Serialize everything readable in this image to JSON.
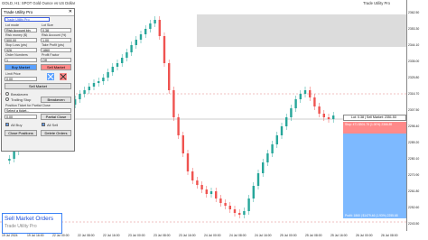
{
  "chart_header": {
    "symbol_line": "GOLD, H1:  SPOT Gold Ounce vs US Dollar",
    "indicator_title": "Trade Utility Pro"
  },
  "price_axis": [
    "2362.50",
    "2353.30",
    "2344.10",
    "2335.00",
    "2325.80",
    "2316.70",
    "2307.50",
    "2298.40",
    "2289.20",
    "2280.10",
    "2270.90",
    "2261.80",
    "2252.60",
    "2243.50"
  ],
  "time_axis": [
    "19 Jul 2024",
    "19 Jul 16:00",
    "22 Jul 00:00",
    "22 Jul 08:00",
    "22 Jul 16:00",
    "23 Jul 00:00",
    "23 Jul 08:00",
    "23 Jul 16:00",
    "24 Jul 00:00",
    "24 Jul 08:00",
    "24 Jul 16:00",
    "25 Jul 00:00",
    "25 Jul 08:00",
    "25 Jul 16:00",
    "26 Jul 00:00",
    "26 Jul 08:00"
  ],
  "panel": {
    "title": "Trade Utility Pro",
    "close": "✕",
    "lot_mode_label": "Lot mode",
    "lot_size_label": "Lot Size",
    "lot_mode_value": "Risk Account bin",
    "lot_size_value": "0.38",
    "risk_money_label": "Risk money ($)",
    "risk_pct_label": "Risk Account (%)",
    "risk_money_value": "500.00",
    "risk_pct_value": "1.00",
    "sl_label": "Stop Loss (pts)",
    "tp_label": "Take Profit (pts)",
    "sl_value": "926",
    "tp_value": "1860",
    "orders_label": "Order Numbers",
    "factor_label": "Profit Factor",
    "orders_value": "1",
    "factor_value": "Off",
    "buy_button": "Buy Market",
    "sell_button": "Sell Market",
    "limit_label": "Limit Price",
    "limit_value": "0.00",
    "sell_market_button": "Sell Market",
    "breakeven_label": "Breakeven",
    "trailing_label": "Trailing Stop",
    "breakeven_button": "Breakeven",
    "partial_label": "Position Ticket for Partial Close",
    "ticket_placeholder": "Select a ticket...",
    "partial_value": "0.00",
    "partial_button": "Partial Close",
    "all_buy": "All Buy",
    "all_sell": "All Sell",
    "close_positions": "Close Positions",
    "delete_orders": "Delete Orders"
  },
  "trade_levels": {
    "sl_label": "Stop: 471 $501.75 (1.00%) 2366.89",
    "lot_label": "Lot: 0.38 | Sell Market: 2351.53",
    "tp_label": "Profit: 1860 | $1479.46 (1.93%) 2255.68"
  },
  "bottom_label": {
    "title": "Sell Market Orders",
    "subtitle": "Trade Utility Pro"
  }
}
